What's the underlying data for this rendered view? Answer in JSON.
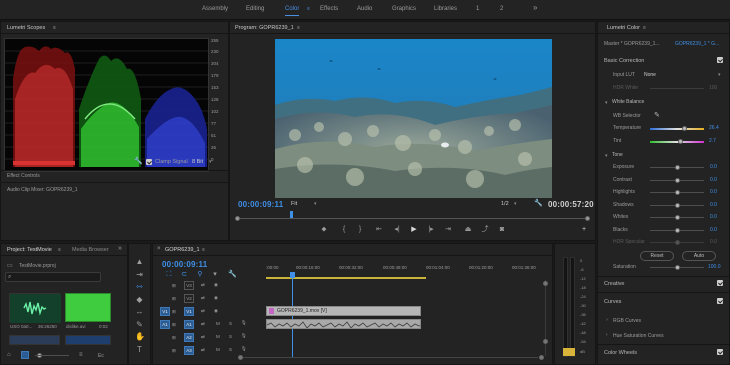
{
  "workspaces": {
    "tabs": [
      "Assembly",
      "Editing",
      "Color",
      "Effects",
      "Audio",
      "Graphics",
      "Libraries",
      "1",
      "2"
    ],
    "more": "»"
  },
  "scopes": {
    "title": "Lumetri Scopes",
    "ticks_right": [
      "255",
      "230",
      "204",
      "179",
      "153",
      "128",
      "102",
      "77",
      "51",
      "26",
      "0"
    ],
    "clamp_label": "Clamp Signal",
    "bit_depth": "8 Bit",
    "effect_controls": "Effect Controls",
    "audio_mixer": "Audio Clip Mixer: GOPR6239_1"
  },
  "program": {
    "title": "Program: GOPR6239_1",
    "timecode": "00:00:09:11",
    "fit": "Fit",
    "resolution": "1/2",
    "duration": "00:00:57:20"
  },
  "lumetri": {
    "title": "Lumetri Color",
    "master": "Master * GOPR6239_1...",
    "clip": "GOPR6239_1 * G...",
    "basic_correction": "Basic Correction",
    "input_lut_label": "Input LUT",
    "input_lut_value": "None",
    "hdr_white_label": "HDR White",
    "hdr_white_value": "100",
    "white_balance": "White Balance",
    "wb_selector": "WB Selector",
    "temperature_label": "Temperature",
    "temperature_value": "26.4",
    "tint_label": "Tint",
    "tint_value": "2.7",
    "tone": "Tone",
    "tone_rows": [
      {
        "label": "Exposure",
        "value": "0.0"
      },
      {
        "label": "Contrast",
        "value": "0.0"
      },
      {
        "label": "Highlights",
        "value": "0.0"
      },
      {
        "label": "Shadows",
        "value": "0.0"
      },
      {
        "label": "Whites",
        "value": "0.0"
      },
      {
        "label": "Blacks",
        "value": "0.0"
      },
      {
        "label": "HDR Specular",
        "value": "0.0"
      }
    ],
    "reset": "Reset",
    "auto": "Auto",
    "saturation_label": "Saturation",
    "saturation_value": "100.0",
    "creative": "Creative",
    "curves": "Curves",
    "rgb_curves": "RGB Curves",
    "hue_sat_curves": "Hue Saturation Curves",
    "color_wheels": "Color Wheels"
  },
  "project": {
    "tab_project": "Project: TestMovie",
    "tab_media": "Media Browser",
    "file": "TestMovie.prproj",
    "items": [
      {
        "name": "USO 0a0...",
        "duration": "36:26250"
      },
      {
        "name": "dislike.avi",
        "duration": "0:02"
      }
    ],
    "ec_label": "Ec"
  },
  "timeline": {
    "title": "GOPR6239_1",
    "timecode": "00:00:09:11",
    "ruler": [
      ":00:00",
      "00:00:16:00",
      "00:00:32:00",
      "00:00:48:00",
      "00:01:04:00",
      "00:01:20:00",
      "00:01:36:00"
    ],
    "tracks": [
      {
        "src": "",
        "name": "V3",
        "kind": "video"
      },
      {
        "src": "",
        "name": "V2",
        "kind": "video"
      },
      {
        "src": "V1",
        "name": "V1",
        "kind": "video"
      },
      {
        "src": "A1",
        "name": "A1",
        "kind": "audio"
      },
      {
        "src": "",
        "name": "A2",
        "kind": "audio"
      },
      {
        "src": "",
        "name": "A3",
        "kind": "audio"
      }
    ],
    "clip_label": "GOPR6239_1.mov [V]",
    "audio_meter_ticks": [
      "0",
      "-6",
      "-12",
      "-18",
      "-24",
      "-30",
      "-36",
      "-42",
      "-48",
      "-54",
      "dB"
    ]
  },
  "colors": {
    "accent": "#3f8fe6",
    "panel": "#232323",
    "clip_video": "#b7b7b7",
    "clip_audio": "#a9a9a9",
    "scope_red": "#c42a2a",
    "scope_green": "#2fbf2f",
    "scope_blue": "#2f3fd0"
  }
}
